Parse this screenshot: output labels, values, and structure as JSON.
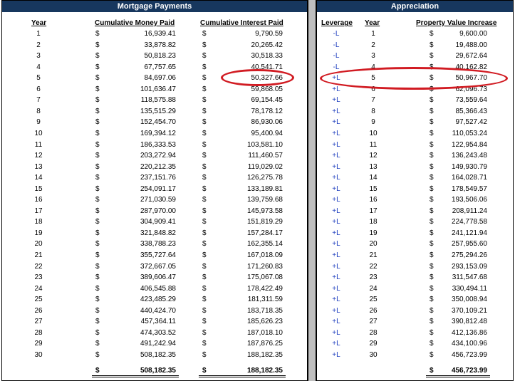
{
  "mortgage": {
    "title": "Mortgage Payments",
    "headers": {
      "year": "Year",
      "money": "Cumulative Money Paid",
      "interest": "Cumulative Interest Paid"
    },
    "rows": [
      [
        "1",
        "16,939.41",
        "9,790.59"
      ],
      [
        "2",
        "33,878.82",
        "20,265.42"
      ],
      [
        "3",
        "50,818.23",
        "30,518.33"
      ],
      [
        "4",
        "67,757.65",
        "40,541.71"
      ],
      [
        "5",
        "84,697.06",
        "50,327.66"
      ],
      [
        "6",
        "101,636.47",
        "59,868.05"
      ],
      [
        "7",
        "118,575.88",
        "69,154.45"
      ],
      [
        "8",
        "135,515.29",
        "78,178.12"
      ],
      [
        "9",
        "152,454.70",
        "86,930.06"
      ],
      [
        "10",
        "169,394.12",
        "95,400.94"
      ],
      [
        "11",
        "186,333.53",
        "103,581.10"
      ],
      [
        "12",
        "203,272.94",
        "111,460.57"
      ],
      [
        "13",
        "220,212.35",
        "119,029.02"
      ],
      [
        "14",
        "237,151.76",
        "126,275.78"
      ],
      [
        "15",
        "254,091.17",
        "133,189.81"
      ],
      [
        "16",
        "271,030.59",
        "139,759.68"
      ],
      [
        "17",
        "287,970.00",
        "145,973.58"
      ],
      [
        "18",
        "304,909.41",
        "151,819.29"
      ],
      [
        "19",
        "321,848.82",
        "157,284.17"
      ],
      [
        "20",
        "338,788.23",
        "162,355.14"
      ],
      [
        "21",
        "355,727.64",
        "167,018.09"
      ],
      [
        "22",
        "372,667.05",
        "171,260.83"
      ],
      [
        "23",
        "389,606.47",
        "175,067.08"
      ],
      [
        "24",
        "406,545.88",
        "178,422.49"
      ],
      [
        "25",
        "423,485.29",
        "181,311.59"
      ],
      [
        "26",
        "440,424.70",
        "183,718.35"
      ],
      [
        "27",
        "457,364.11",
        "185,626.23"
      ],
      [
        "28",
        "474,303.52",
        "187,018.10"
      ],
      [
        "29",
        "491,242.94",
        "187,876.25"
      ],
      [
        "30",
        "508,182.35",
        "188,182.35"
      ]
    ],
    "currency_symbol": "$",
    "total_money": "508,182.35",
    "total_interest": "188,182.35"
  },
  "appreciation": {
    "title": "Appreciation",
    "headers": {
      "leverage": "Leverage",
      "year": "Year",
      "increase": "Property Value Increase"
    },
    "rows": [
      [
        "-L",
        "1",
        "9,600.00"
      ],
      [
        "-L",
        "2",
        "19,488.00"
      ],
      [
        "-L",
        "3",
        "29,672.64"
      ],
      [
        "-L",
        "4",
        "40,162.82"
      ],
      [
        "+L",
        "5",
        "50,967.70"
      ],
      [
        "+L",
        "6",
        "62,096.73"
      ],
      [
        "+L",
        "7",
        "73,559.64"
      ],
      [
        "+L",
        "8",
        "85,366.43"
      ],
      [
        "+L",
        "9",
        "97,527.42"
      ],
      [
        "+L",
        "10",
        "110,053.24"
      ],
      [
        "+L",
        "11",
        "122,954.84"
      ],
      [
        "+L",
        "12",
        "136,243.48"
      ],
      [
        "+L",
        "13",
        "149,930.79"
      ],
      [
        "+L",
        "14",
        "164,028.71"
      ],
      [
        "+L",
        "15",
        "178,549.57"
      ],
      [
        "+L",
        "16",
        "193,506.06"
      ],
      [
        "+L",
        "17",
        "208,911.24"
      ],
      [
        "+L",
        "18",
        "224,778.58"
      ],
      [
        "+L",
        "19",
        "241,121.94"
      ],
      [
        "+L",
        "20",
        "257,955.60"
      ],
      [
        "+L",
        "21",
        "275,294.26"
      ],
      [
        "+L",
        "22",
        "293,153.09"
      ],
      [
        "+L",
        "23",
        "311,547.68"
      ],
      [
        "+L",
        "24",
        "330,494.11"
      ],
      [
        "+L",
        "25",
        "350,008.94"
      ],
      [
        "+L",
        "26",
        "370,109.21"
      ],
      [
        "+L",
        "27",
        "390,812.48"
      ],
      [
        "+L",
        "28",
        "412,136.86"
      ],
      [
        "+L",
        "29",
        "434,100.96"
      ],
      [
        "+L",
        "30",
        "456,723.99"
      ]
    ],
    "currency_symbol": "$",
    "total_increase": "456,723.99"
  },
  "highlight": {
    "year": "5",
    "color": "#d11b22"
  },
  "colors": {
    "band": "#17375e",
    "leverage_text": "#1f3fbf",
    "divider": "#bfbfbf"
  }
}
